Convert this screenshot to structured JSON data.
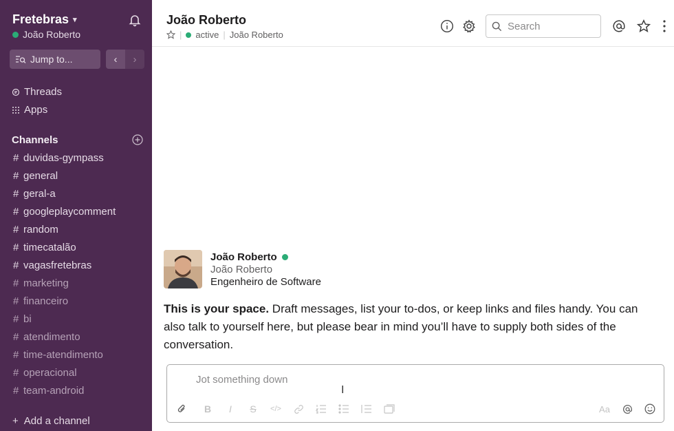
{
  "workspace": {
    "name": "Fretebras",
    "user": "João Roberto"
  },
  "sidebar": {
    "jump_label": "Jump to...",
    "links": [
      {
        "label": "Threads"
      },
      {
        "label": "Apps"
      }
    ],
    "channels_heading": "Channels",
    "channels": [
      {
        "name": "duvidas-gympass",
        "bright": true
      },
      {
        "name": "general",
        "bright": true
      },
      {
        "name": "geral-a",
        "bright": true
      },
      {
        "name": "googleplaycomment",
        "bright": true
      },
      {
        "name": "random",
        "bright": true
      },
      {
        "name": "timecatalão",
        "bright": true
      },
      {
        "name": "vagasfretebras",
        "bright": true
      },
      {
        "name": "marketing",
        "bright": false
      },
      {
        "name": "financeiro",
        "bright": false
      },
      {
        "name": "bi",
        "bright": false
      },
      {
        "name": "atendimento",
        "bright": false
      },
      {
        "name": "time-atendimento",
        "bright": false
      },
      {
        "name": "operacional",
        "bright": false
      },
      {
        "name": "team-android",
        "bright": false
      }
    ],
    "add_channel_label": "Add a channel"
  },
  "header": {
    "title": "João Roberto",
    "status": "active",
    "username": "João Roberto",
    "search_placeholder": "Search"
  },
  "profile": {
    "name": "João Roberto",
    "username": "João Roberto",
    "job_title": "Engenheiro de Software"
  },
  "intro": {
    "bold": "This is your space.",
    "text": " Draft messages, list your to-dos, or keep links and files handy. You can also talk to yourself here, but please bear in mind you’ll have to supply both sides of the conversation."
  },
  "composer": {
    "placeholder": "Jot something down"
  },
  "colors": {
    "sidebar_bg": "#4d2a51",
    "presence": "#2bac76"
  }
}
